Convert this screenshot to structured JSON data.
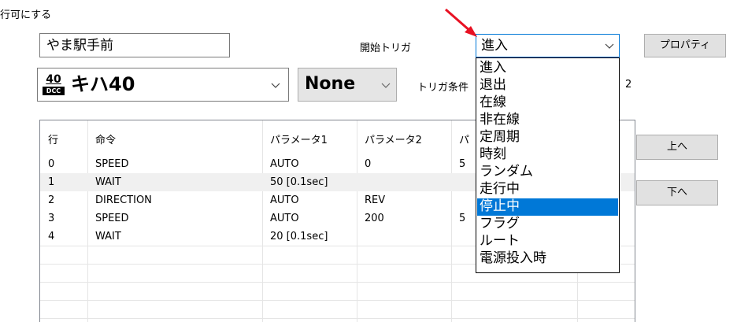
{
  "enable_label": "行可にする",
  "station_name": "やま駅手前",
  "start_trigger_label": "開始トリガ",
  "trigger_selected": "進入",
  "properties_button": "プロパティ",
  "loco": {
    "dcc_number": "40",
    "dcc_badge": "DCC",
    "name": "キハ40"
  },
  "condition_value": "None",
  "trigger_condition_label": "トリガ条件",
  "trigger_condition_suffix": "2",
  "table": {
    "headers": [
      "行",
      "命令",
      "パラメータ1",
      "パラメータ2",
      "パ"
    ],
    "rows": [
      [
        "0",
        "SPEED",
        "AUTO",
        "0",
        "5"
      ],
      [
        "1",
        "WAIT",
        "50 [0.1sec]",
        "",
        ""
      ],
      [
        "2",
        "DIRECTION",
        "AUTO",
        "REV",
        ""
      ],
      [
        "3",
        "SPEED",
        "AUTO",
        "200",
        "5"
      ],
      [
        "4",
        "WAIT",
        "20 [0.1sec]",
        "",
        ""
      ]
    ]
  },
  "up_button": "上へ",
  "down_button": "下へ",
  "dropdown": {
    "items": [
      "進入",
      "退出",
      "在線",
      "非在線",
      "定周期",
      "時刻",
      "ランダム",
      "走行中",
      "停止中",
      "フラグ",
      "ルート",
      "電源投入時"
    ],
    "highlighted": "停止中"
  },
  "colors": {
    "highlight": "#0078d7",
    "arrow": "#e81123"
  }
}
